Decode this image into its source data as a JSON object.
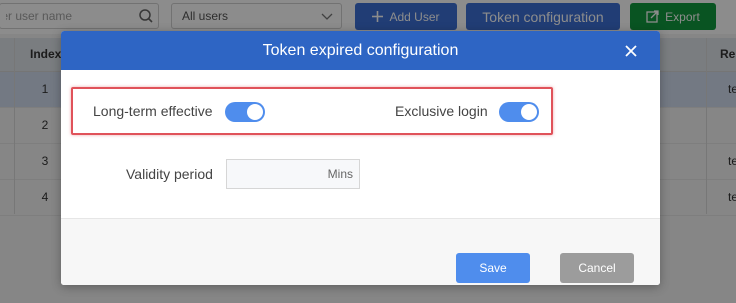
{
  "toolbar": {
    "search_placeholder": "ter user name",
    "user_filter": "All users",
    "add_user_label": "Add User",
    "token_config_label": "Token configuration",
    "export_label": "Export"
  },
  "table": {
    "headers": {
      "index": "Index",
      "right": "Re"
    },
    "rows": [
      {
        "index": "1",
        "right": "te"
      },
      {
        "index": "2",
        "right": ""
      },
      {
        "index": "3",
        "right": "te"
      },
      {
        "index": "4",
        "right": "te"
      }
    ]
  },
  "modal": {
    "title": "Token expired configuration",
    "long_term_label": "Long-term effective",
    "long_term_on": true,
    "exclusive_label": "Exclusive login",
    "exclusive_on": true,
    "validity_label": "Validity period",
    "validity_value": "",
    "validity_unit": "Mins",
    "save_label": "Save",
    "cancel_label": "Cancel"
  },
  "colors": {
    "primary": "#2e65c4",
    "switch_on": "#4f8ded",
    "export": "#119a3e",
    "highlight": "#e0525a"
  }
}
